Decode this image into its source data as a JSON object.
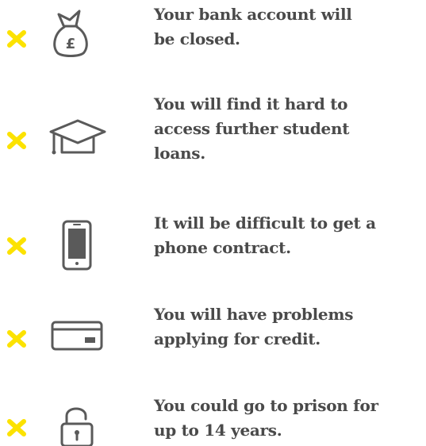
{
  "colors": {
    "cross": "#fce200",
    "icon_stroke": "#5a5a5a",
    "text": "#4a4a4a"
  },
  "items": [
    {
      "icon": "money-bag-pound-icon",
      "symbol": "£",
      "text": "Your bank account will\nbe closed."
    },
    {
      "icon": "graduation-cap-icon",
      "text": "You will find it hard to\naccess further student\nloans."
    },
    {
      "icon": "mobile-phone-icon",
      "text": "It will be difficult to get a\nphone contract."
    },
    {
      "icon": "credit-card-icon",
      "text": "You will have problems\napplying for credit."
    },
    {
      "icon": "padlock-open-icon",
      "text": "You could go to prison for\nup to 14 years."
    }
  ]
}
